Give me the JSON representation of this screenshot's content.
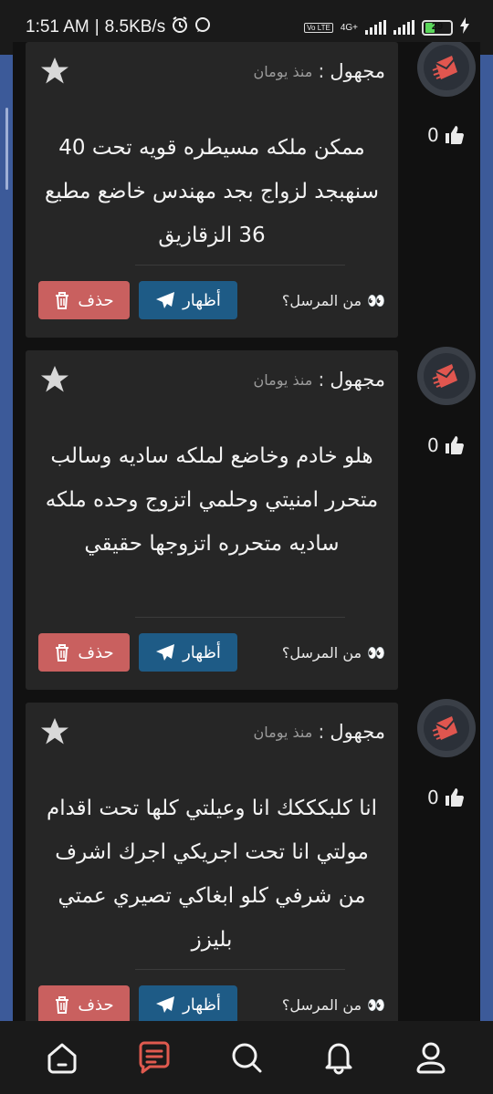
{
  "status_bar": {
    "time": "1:51 AM",
    "speed": "8.5KB/s",
    "network": "4G+",
    "volte": "Vo LTE",
    "battery": "29"
  },
  "colors": {
    "side_band": "#3c5a99",
    "delete_button": "#c9605f",
    "show_button": "#1e5b86",
    "active_nav": "#e05a4f"
  },
  "messages": [
    {
      "author": "مجهول",
      "separator": ":",
      "time": "منذ يومان",
      "text": "ممكن ملكه مسيطره قويه تحت 40 سنهبجد لزواج بجد مهندس خاضع مطيع 36 الزقازيق",
      "likes": "0",
      "sender_label": "من المرسل؟",
      "sender_emoji": "👀",
      "show_label": "أظهار",
      "delete_label": "حذف"
    },
    {
      "author": "مجهول",
      "separator": ":",
      "time": "منذ يومان",
      "text": "هلو خادم وخاضع لملكه ساديه وسالب متحرر امنيتي وحلمي اتزوج وحده ملكه ساديه متحرره اتزوجها حقيقي",
      "likes": "0",
      "sender_label": "من المرسل؟",
      "sender_emoji": "👀",
      "show_label": "أظهار",
      "delete_label": "حذف"
    },
    {
      "author": "مجهول",
      "separator": ":",
      "time": "منذ يومان",
      "text": "انا كلبكككك انا وعيلتي كلها تحت اقدام مولتي انا تحت اجريكي اجرك اشرف من شرفي كلو ابغاكي تصيري عمتي بليزز",
      "likes": "0",
      "sender_label": "من المرسل؟",
      "sender_emoji": "👀",
      "show_label": "أظهار",
      "delete_label": "حذف"
    }
  ],
  "bottom_nav": [
    {
      "icon": "home-icon"
    },
    {
      "icon": "messages-icon"
    },
    {
      "icon": "search-icon"
    },
    {
      "icon": "bell-icon"
    },
    {
      "icon": "profile-icon"
    }
  ]
}
